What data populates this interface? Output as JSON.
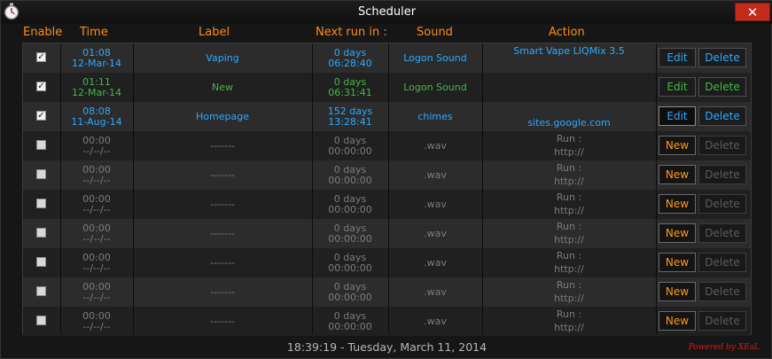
{
  "window": {
    "title": "Scheduler",
    "close_label": "✕"
  },
  "headers": {
    "enable": "Enable",
    "time": "Time",
    "label": "Label",
    "next_run": "Next run in :",
    "sound": "Sound",
    "action": "Action"
  },
  "rows": [
    {
      "checked": true,
      "time": "01:08",
      "date": "12-Mar-14",
      "label": "Vaping",
      "next_days": "0 days",
      "next_time": "06:28:40",
      "sound": "Logon Sound",
      "action_top": "Smart Vape LIQMix 3.5",
      "action_bottom": "",
      "primary_button": "Edit",
      "delete_button": "Delete"
    },
    {
      "checked": true,
      "time": "01:11",
      "date": "12-Mar-14",
      "label": "New",
      "next_days": "0 days",
      "next_time": "06:31:41",
      "sound": "Logon Sound",
      "action_top": "",
      "action_bottom": "",
      "primary_button": "Edit",
      "delete_button": "Delete"
    },
    {
      "checked": true,
      "time": "08:08",
      "date": "11-Aug-14",
      "label": "Homepage",
      "next_days": "152 days",
      "next_time": "13:28:41",
      "sound": "chimes",
      "action_top": "",
      "action_bottom": "sites.google.com",
      "primary_button": "Edit",
      "delete_button": "Delete"
    },
    {
      "checked": false,
      "time": "00:00",
      "date": "--/--/--",
      "label": "-------",
      "next_days": "0 days",
      "next_time": "00:00:00",
      "sound": ".wav",
      "action_top": "Run :",
      "action_bottom": "http://",
      "primary_button": "New",
      "delete_button": "Delete"
    },
    {
      "checked": false,
      "time": "00:00",
      "date": "--/--/--",
      "label": "-------",
      "next_days": "0 days",
      "next_time": "00:00:00",
      "sound": ".wav",
      "action_top": "Run :",
      "action_bottom": "http://",
      "primary_button": "New",
      "delete_button": "Delete"
    },
    {
      "checked": false,
      "time": "00:00",
      "date": "--/--/--",
      "label": "-------",
      "next_days": "0 days",
      "next_time": "00:00:00",
      "sound": ".wav",
      "action_top": "Run :",
      "action_bottom": "http://",
      "primary_button": "New",
      "delete_button": "Delete"
    },
    {
      "checked": false,
      "time": "00:00",
      "date": "--/--/--",
      "label": "-------",
      "next_days": "0 days",
      "next_time": "00:00:00",
      "sound": ".wav",
      "action_top": "Run :",
      "action_bottom": "http://",
      "primary_button": "New",
      "delete_button": "Delete"
    },
    {
      "checked": false,
      "time": "00:00",
      "date": "--/--/--",
      "label": "-------",
      "next_days": "0 days",
      "next_time": "00:00:00",
      "sound": ".wav",
      "action_top": "Run :",
      "action_bottom": "http://",
      "primary_button": "New",
      "delete_button": "Delete"
    },
    {
      "checked": false,
      "time": "00:00",
      "date": "--/--/--",
      "label": "-------",
      "next_days": "0 days",
      "next_time": "00:00:00",
      "sound": ".wav",
      "action_top": "Run :",
      "action_bottom": "http://",
      "primary_button": "New",
      "delete_button": "Delete"
    },
    {
      "checked": false,
      "time": "00:00",
      "date": "--/--/--",
      "label": "-------",
      "next_days": "0 days",
      "next_time": "00:00:00",
      "sound": ".wav",
      "action_top": "Run :",
      "action_bottom": "http://",
      "primary_button": "New",
      "delete_button": "Delete"
    }
  ],
  "status": {
    "clock": "18:39:19  -  Tuesday, March 11, 2014",
    "powered_by": "Powered by XEaL"
  },
  "colors": {
    "active": "#2fa8ff",
    "highlight": "#44b844",
    "inactive": "#7c7c7c",
    "header": "#ff8c1a",
    "new_button": "#ff9a1a",
    "close_button": "#c42b1c"
  },
  "icons": {
    "app": "stopwatch-icon",
    "close": "close-icon",
    "check": "checkmark-icon"
  }
}
